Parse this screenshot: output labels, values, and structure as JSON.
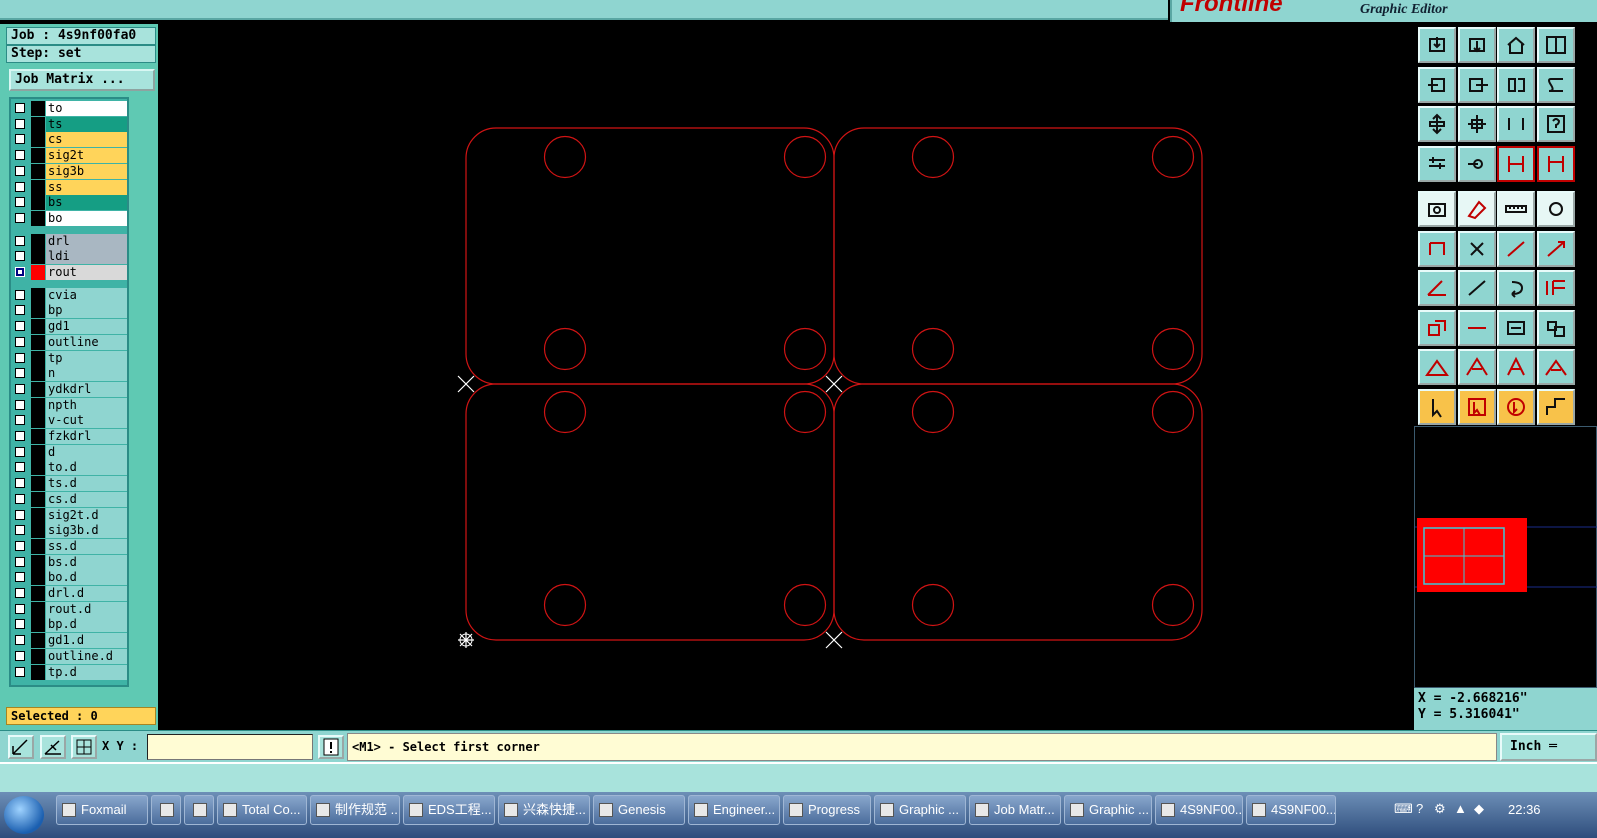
{
  "window": {
    "brand_logo": "Frontline",
    "brand_subtitle": "Graphic Editor"
  },
  "left_panel": {
    "job_line": "Job : 4s9nf00fa0",
    "step_line": "Step: set",
    "job_matrix_button": "Job Matrix ...",
    "selected_line": "Selected : 0",
    "layers": [
      {
        "name": "to",
        "color": "#ffffff"
      },
      {
        "name": "ts",
        "color": "#159e84"
      },
      {
        "name": "cs",
        "color": "#ffd45a"
      },
      {
        "name": "sig2t",
        "color": "#ffd45a"
      },
      {
        "name": "sig3b",
        "color": "#ffd45a"
      },
      {
        "name": "ss",
        "color": "#ffd45a"
      },
      {
        "name": "bs",
        "color": "#159e84"
      },
      {
        "name": "bo",
        "color": "#ffffff"
      },
      {
        "name": "drl",
        "color": "#a9b7c2"
      },
      {
        "name": "ldi",
        "color": "#a9b7c2"
      },
      {
        "name": "rout",
        "color": "#d9d9d9",
        "active": true
      },
      {
        "name": "cvia",
        "color": "#8fd5d0"
      },
      {
        "name": "bp",
        "color": "#8fd5d0"
      },
      {
        "name": "gd1",
        "color": "#8fd5d0"
      },
      {
        "name": "outline",
        "color": "#8fd5d0"
      },
      {
        "name": "tp",
        "color": "#8fd5d0"
      },
      {
        "name": "n",
        "color": "#8fd5d0"
      },
      {
        "name": "ydkdrl",
        "color": "#8fd5d0"
      },
      {
        "name": "npth",
        "color": "#8fd5d0"
      },
      {
        "name": "v-cut",
        "color": "#8fd5d0"
      },
      {
        "name": "fzkdrl",
        "color": "#8fd5d0"
      },
      {
        "name": "d",
        "color": "#8fd5d0"
      },
      {
        "name": "to.d",
        "color": "#8fd5d0"
      },
      {
        "name": "ts.d",
        "color": "#8fd5d0"
      },
      {
        "name": "cs.d",
        "color": "#8fd5d0"
      },
      {
        "name": "sig2t.d",
        "color": "#8fd5d0"
      },
      {
        "name": "sig3b.d",
        "color": "#8fd5d0"
      },
      {
        "name": "ss.d",
        "color": "#8fd5d0"
      },
      {
        "name": "bs.d",
        "color": "#8fd5d0"
      },
      {
        "name": "bo.d",
        "color": "#8fd5d0"
      },
      {
        "name": "drl.d",
        "color": "#8fd5d0"
      },
      {
        "name": "rout.d",
        "color": "#8fd5d0"
      },
      {
        "name": "bp.d",
        "color": "#8fd5d0"
      },
      {
        "name": "gd1.d",
        "color": "#8fd5d0"
      },
      {
        "name": "outline.d",
        "color": "#8fd5d0"
      },
      {
        "name": "tp.d",
        "color": "#8fd5d0"
      }
    ]
  },
  "toolbar": {
    "tools": [
      "move-up-icon",
      "move-down-icon",
      "home-icon",
      "grid-xy-icon",
      "import-left-icon",
      "export-right-icon",
      "split-icon",
      "s-curve-icon",
      "fit-vertical-icon",
      "zoom-center-icon",
      "ratio-icon",
      "help-icon",
      "options-icon",
      "pin-icon",
      "snap-red-icon",
      "snap-red2-icon",
      "camera-icon",
      "draw-shape-icon",
      "ruler-icon",
      "pad-select-icon",
      "node-icon",
      "close-x-icon",
      "line-point-icon",
      "arrow-point-icon",
      "angle-icon",
      "slash-icon",
      "rotate-icon",
      "mirror-icon",
      "copy-square-icon",
      "minus-line-icon",
      "measure-box-icon",
      "group-icon",
      "triangle-add-icon",
      "triangle-edit-icon",
      "text-a-icon",
      "triangle-x-icon",
      "pointer-icon",
      "pointer-box-icon",
      "pointer-circle-icon",
      "route-icon"
    ],
    "selected_tools": [
      "snap-red-icon",
      "snap-red2-icon"
    ],
    "light_row": 4,
    "orange_row": 9
  },
  "coords": {
    "x_text": "X = -2.668216\"",
    "y_text": "Y = 5.316041\""
  },
  "command": {
    "xy_label": "X Y :",
    "xy_value": "",
    "prompt": "<M1> - Select first corner",
    "unit_button": "Inch ═"
  },
  "canvas": {
    "line_color": "#d11414",
    "marker_color": "#ffffff"
  },
  "taskbar": {
    "items": [
      "Foxmail",
      "",
      "",
      "Total Co...",
      "制作规范 ...",
      "EDS工程...",
      "兴森快捷...",
      "Genesis",
      "Engineer...",
      "Progress",
      "Graphic ...",
      "Job Matr...",
      "Graphic ...",
      "4S9NF00...",
      "4S9NF00..."
    ],
    "clock": "22:36"
  }
}
